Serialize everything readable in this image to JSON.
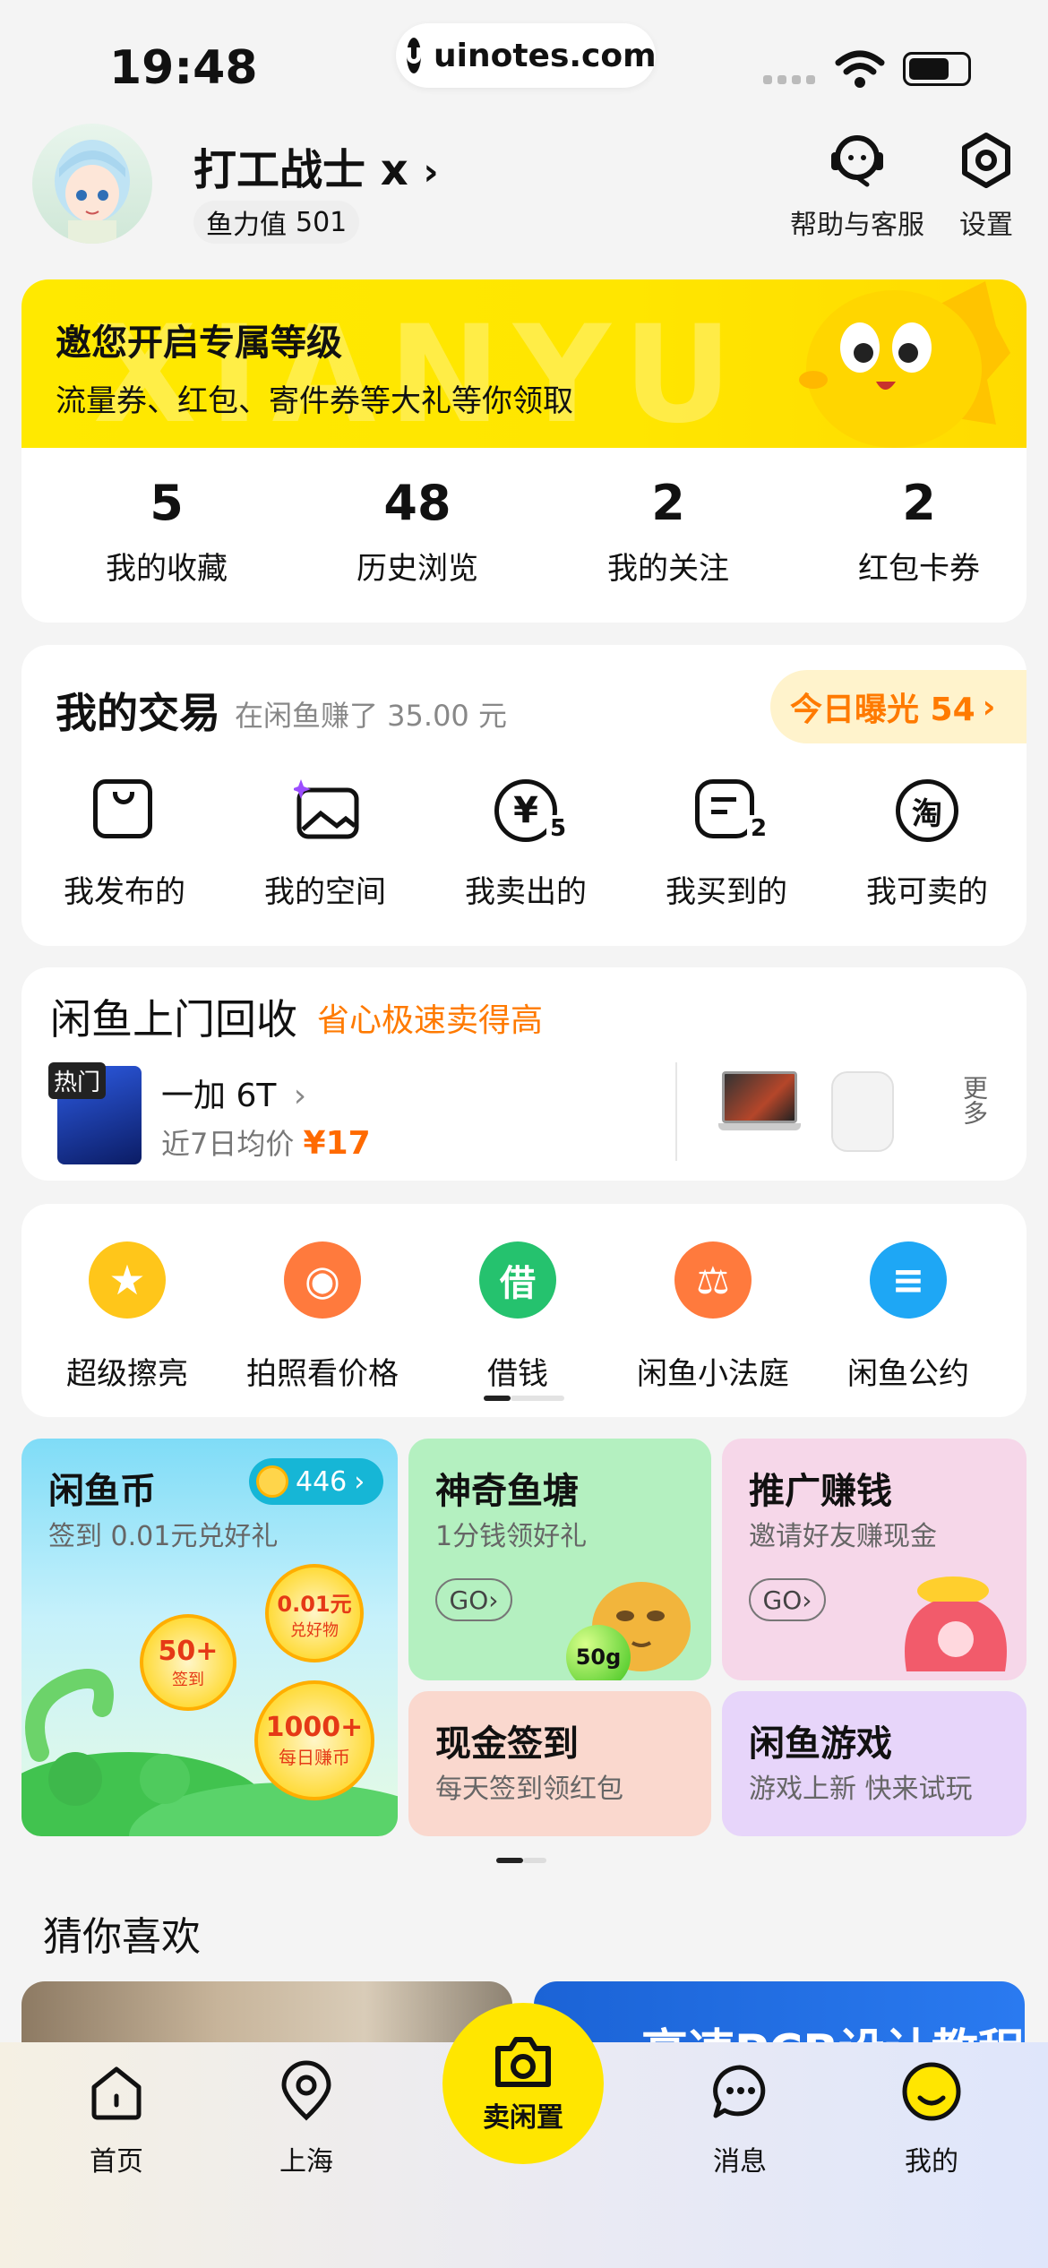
{
  "status": {
    "time": "19:48",
    "url": "uinotes.com"
  },
  "header": {
    "user_name": "打工战士 x",
    "power_label": "鱼力值",
    "power_value": "501",
    "help_label": "帮助与客服",
    "settings_label": "设置"
  },
  "banner": {
    "title": "邀您开启专属等级",
    "subtitle": "流量券、红包、寄件券等大礼等你领取",
    "watermark": "XIANYU",
    "stats": [
      {
        "value": "5",
        "label": "我的收藏"
      },
      {
        "value": "48",
        "label": "历史浏览"
      },
      {
        "value": "2",
        "label": "我的关注"
      },
      {
        "value": "2",
        "label": "红包卡券"
      }
    ]
  },
  "trade": {
    "title": "我的交易",
    "earned": "在闲鱼赚了 35.00 元",
    "exposure": "今日曝光 54",
    "items": [
      {
        "label": "我发布的",
        "icon": "bag-icon",
        "badge": ""
      },
      {
        "label": "我的空间",
        "icon": "image-sparkle-icon",
        "badge": ""
      },
      {
        "label": "我卖出的",
        "icon": "yuan-icon",
        "badge": "5"
      },
      {
        "label": "我买到的",
        "icon": "receipt-icon",
        "badge": "2"
      },
      {
        "label": "我可卖的",
        "icon": "tao-icon",
        "badge": "",
        "glyph": "淘"
      }
    ]
  },
  "recycle": {
    "title": "闲鱼上门回收",
    "subtitle": "省心极速卖得高",
    "hot_tag": "热门",
    "device": "一加 6T",
    "avg_label": "近7日均价",
    "avg_price": "¥17",
    "more": "更多"
  },
  "features": [
    {
      "label": "超级擦亮",
      "color": "#ffc61a",
      "icon": "sparkle-star-icon",
      "glyph": "★"
    },
    {
      "label": "拍照看价格",
      "color": "#ff7a3d",
      "icon": "camera-icon",
      "glyph": "◉"
    },
    {
      "label": "借钱",
      "color": "#25c26e",
      "icon": "borrow-icon",
      "glyph": "借"
    },
    {
      "label": "闲鱼小法庭",
      "color": "#ff7a3d",
      "icon": "gavel-icon",
      "glyph": "⚖"
    },
    {
      "label": "闲鱼公约",
      "color": "#1ea7f5",
      "icon": "briefcase-icon",
      "glyph": "≡"
    }
  ],
  "promos": {
    "coin": {
      "title": "闲鱼币",
      "badge": "446",
      "subtitle": "签到 0.01元兑好礼",
      "b1_big": "50+",
      "b1_small": "签到",
      "b2_big": "0.01元",
      "b2_small": "兑好物",
      "b3_big": "1000+",
      "b3_small": "每日赚币"
    },
    "pond": {
      "title": "神奇鱼塘",
      "subtitle": "1分钱领好礼",
      "go": "GO",
      "weight": "50g"
    },
    "promo": {
      "title": "推广赚钱",
      "subtitle": "邀请好友赚现金",
      "go": "GO"
    },
    "cash": {
      "title": "现金签到",
      "subtitle": "每天签到领红包"
    },
    "games": {
      "title": "闲鱼游戏",
      "subtitle": "游戏上新 快来试玩"
    }
  },
  "guess": {
    "title": "猜你喜欢",
    "card2_text": "高速PCB设计教程"
  },
  "tabs": [
    {
      "label": "首页",
      "icon": "home-icon"
    },
    {
      "label": "上海",
      "icon": "location-icon"
    },
    {
      "label": "卖闲置",
      "icon": "camera-sell-icon"
    },
    {
      "label": "消息",
      "icon": "message-icon"
    },
    {
      "label": "我的",
      "icon": "me-icon"
    }
  ],
  "colors": {
    "brand_yellow": "#ffe600",
    "accent_orange": "#ff7a00"
  }
}
